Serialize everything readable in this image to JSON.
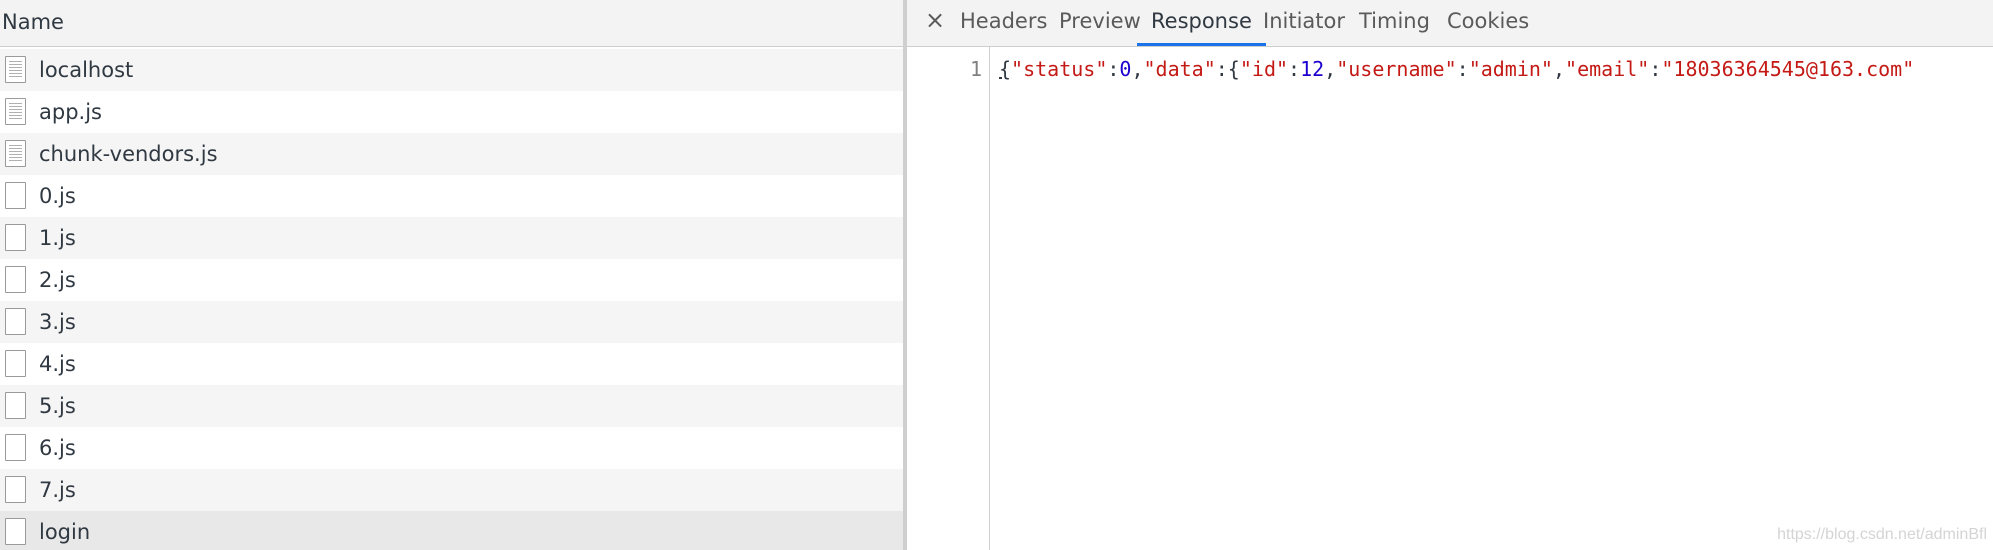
{
  "network": {
    "column_header": "Name",
    "files": [
      {
        "name": "localhost",
        "icon": "document-icon"
      },
      {
        "name": "app.js",
        "icon": "script-icon"
      },
      {
        "name": "chunk-vendors.js",
        "icon": "script-icon"
      },
      {
        "name": "0.js",
        "icon": "file-icon"
      },
      {
        "name": "1.js",
        "icon": "file-icon"
      },
      {
        "name": "2.js",
        "icon": "file-icon"
      },
      {
        "name": "3.js",
        "icon": "file-icon"
      },
      {
        "name": "4.js",
        "icon": "file-icon"
      },
      {
        "name": "5.js",
        "icon": "file-icon"
      },
      {
        "name": "6.js",
        "icon": "file-icon"
      },
      {
        "name": "7.js",
        "icon": "file-icon"
      },
      {
        "name": "login",
        "icon": "file-icon",
        "selected": true
      }
    ]
  },
  "details": {
    "close_symbol": "×",
    "tabs": [
      {
        "label": "Headers"
      },
      {
        "label": "Preview"
      },
      {
        "label": "Response",
        "active": true
      },
      {
        "label": "Initiator"
      },
      {
        "label": "Timing"
      },
      {
        "label": "Cookies"
      }
    ],
    "response": {
      "line_number": "1",
      "tokens": [
        {
          "t": "{",
          "k": "punct"
        },
        {
          "t": "\"status\"",
          "k": "str"
        },
        {
          "t": ":",
          "k": "punct"
        },
        {
          "t": "0",
          "k": "num"
        },
        {
          "t": ",",
          "k": "punct"
        },
        {
          "t": "\"data\"",
          "k": "str"
        },
        {
          "t": ":{",
          "k": "punct"
        },
        {
          "t": "\"id\"",
          "k": "str"
        },
        {
          "t": ":",
          "k": "punct"
        },
        {
          "t": "12",
          "k": "num"
        },
        {
          "t": ",",
          "k": "punct"
        },
        {
          "t": "\"username\"",
          "k": "str"
        },
        {
          "t": ":",
          "k": "punct"
        },
        {
          "t": "\"admin\"",
          "k": "str"
        },
        {
          "t": ",",
          "k": "punct"
        },
        {
          "t": "\"email\"",
          "k": "str"
        },
        {
          "t": ":",
          "k": "punct"
        },
        {
          "t": "\"18036364545@163.com\"",
          "k": "str"
        }
      ]
    },
    "watermark": "https://blog.csdn.net/adminBfl"
  },
  "colors": {
    "accent": "#1a73e8",
    "string": "#c41a16",
    "number": "#1c00cf"
  }
}
